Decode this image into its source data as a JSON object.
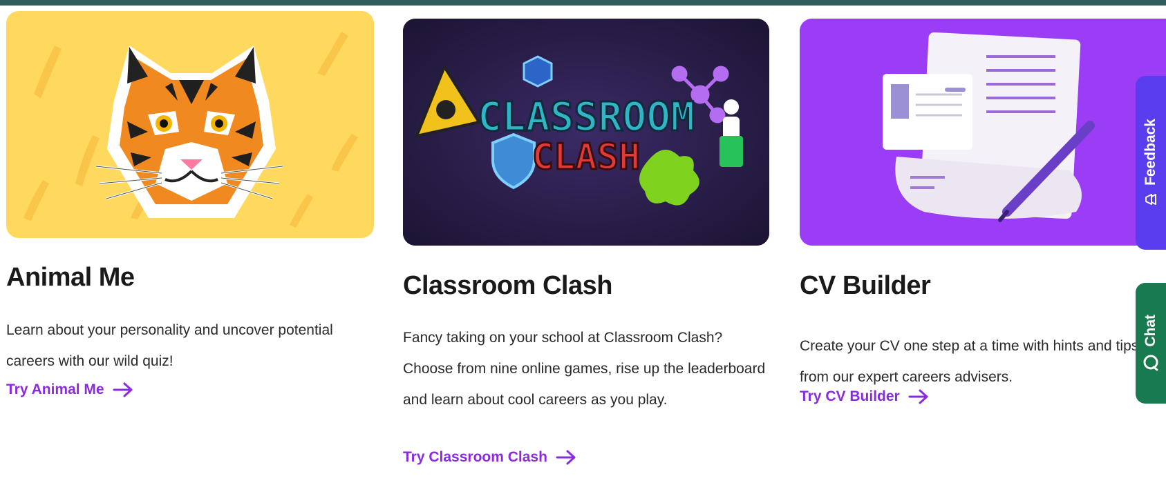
{
  "cards": [
    {
      "title": "Animal Me",
      "description": "Learn about your personality and uncover potential careers with our wild quiz!",
      "link": "Try Animal Me",
      "image": "tiger-illustration"
    },
    {
      "title": "Classroom Clash",
      "description": "Fancy taking on your school at Classroom Clash? Choose from nine online games, rise up the leaderboard and learn about cool careers as you play.",
      "link": "Try Classroom Clash",
      "image": "classroom-clash-logo",
      "logo_line1": "CLASSROOM",
      "logo_line2": "CLASH"
    },
    {
      "title": "CV Builder",
      "description": "Create your CV one step at a time with hints and tips from our expert careers advisers.",
      "link": "Try CV Builder",
      "image": "cv-document-illustration"
    }
  ],
  "side_tabs": {
    "feedback": {
      "label": "Feedback",
      "icon": "megaphone-icon",
      "color": "#5b3df0"
    },
    "chat": {
      "label": "Chat",
      "icon": "chat-bubble-icon",
      "color": "#187a4f"
    }
  },
  "colors": {
    "link": "#8a2be2",
    "topbar": "#2f5c5c",
    "card1_bg": "#ffd95e",
    "card2_bg": "#2a1d45",
    "card3_bg": "#9a3df5"
  }
}
